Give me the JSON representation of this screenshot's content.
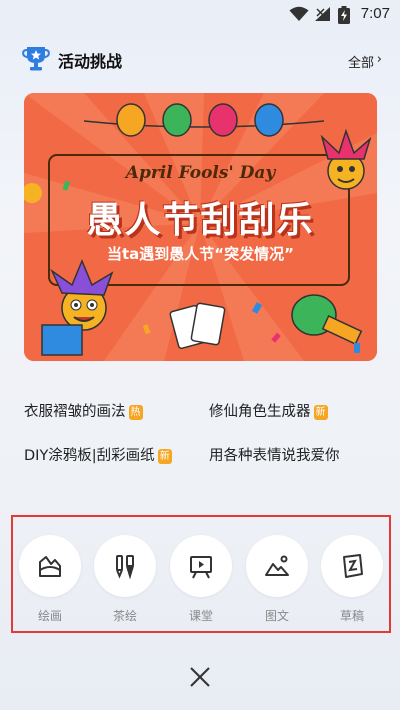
{
  "status_bar": {
    "time": "7:07"
  },
  "header": {
    "title": "活动挑战",
    "all_label": "全部"
  },
  "banner": {
    "english_title": "April Fools' Day",
    "title": "愚人节刮刮乐",
    "subtitle": "当ta遇到愚人节“突发情况”"
  },
  "links": [
    {
      "text": "衣服褶皱的画法",
      "badge": "热"
    },
    {
      "text": "修仙角色生成器",
      "badge": "新"
    },
    {
      "text": "DIY涂鸦板|刮彩画纸",
      "badge": "新"
    },
    {
      "text": "用各种表情说我爱你",
      "badge": ""
    }
  ],
  "tools": [
    {
      "label": "绘画",
      "icon": "paint-icon"
    },
    {
      "label": "茶绘",
      "icon": "brush-pen-icon"
    },
    {
      "label": "课堂",
      "icon": "video-board-icon"
    },
    {
      "label": "图文",
      "icon": "image-icon"
    },
    {
      "label": "草稿",
      "icon": "draft-icon"
    }
  ],
  "colors": {
    "banner_bg": "#f26a45",
    "badge": "#f5a623",
    "highlight_border": "#e53935"
  }
}
